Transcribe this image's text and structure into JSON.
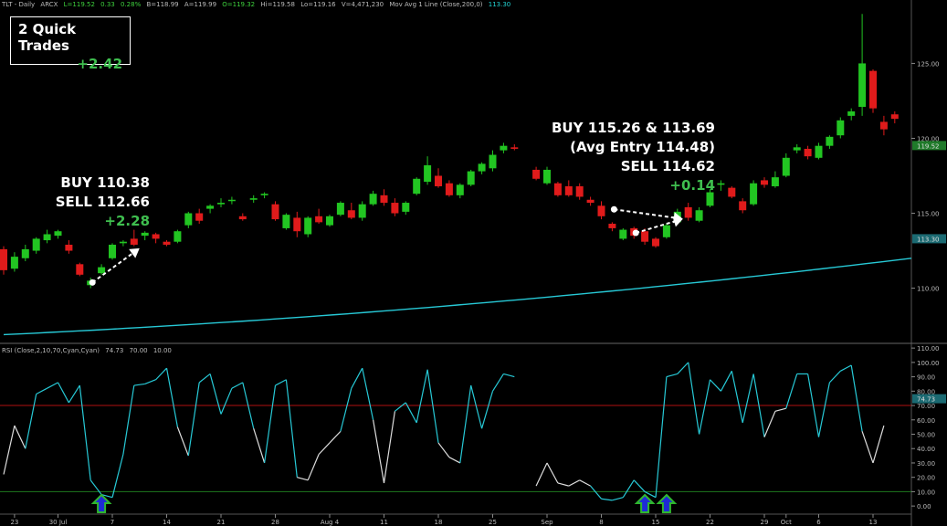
{
  "header": {
    "symbol": "TLT - Daily",
    "exchange": "ARCX",
    "last": "L=119.52",
    "change": "0.33",
    "change_pct": "0.28%",
    "bid": "B=118.99",
    "ask": "A=119.99",
    "open": "O=119.32",
    "high": "Hi=119.58",
    "low": "Lo=119.16",
    "volume": "V=4,471,230",
    "ma_label": "Mov Avg 1 Line (Close,200,0)",
    "ma_value": "113.30"
  },
  "rsi_header": {
    "label": "RSI (Close,2,10,70,Cyan,Cyan)",
    "value": "74.73",
    "overbought": "70.00",
    "oversold": "10.00"
  },
  "summary": {
    "title": "2 Quick Trades",
    "profit": "+2.42"
  },
  "trade1": {
    "buy": "BUY 110.38",
    "sell": "SELL 112.66",
    "profit": "+2.28"
  },
  "trade2": {
    "buy": "BUY 115.26 & 113.69",
    "avg": "(Avg Entry 114.48)",
    "sell": "SELL 114.62",
    "profit": "+0.14"
  },
  "colors": {
    "up": "#22c522",
    "down": "#e01b1b",
    "ma": "#27c9d6",
    "rsi_hi": "#27c9d6",
    "rsi_mid": "#dddddd",
    "ob_line": "#b01010",
    "os_line": "#1e7a1e"
  },
  "chart_data": {
    "type": "candlestick",
    "price_axis": {
      "ticks": [
        "125.00",
        "120.00",
        "115.00",
        "110.00"
      ],
      "last_label": "119.52",
      "ma_label": "113.30",
      "ylim": [
        106.5,
        128.5
      ]
    },
    "rsi_axis": {
      "ticks": [
        "110.00",
        "100.00",
        "90.00",
        "80.00",
        "70.00",
        "60.00",
        "50.00",
        "40.00",
        "30.00",
        "20.00",
        "10.00",
        "0.00"
      ],
      "last_label": "74.73",
      "ylim": [
        -5,
        112
      ]
    },
    "x_labels": [
      {
        "label": "23",
        "i": 1
      },
      {
        "label": "30 Jul",
        "i": 5
      },
      {
        "label": "7",
        "i": 10
      },
      {
        "label": "14",
        "i": 15
      },
      {
        "label": "21",
        "i": 20
      },
      {
        "label": "28",
        "i": 25
      },
      {
        "label": "Aug 4",
        "i": 30
      },
      {
        "label": "11",
        "i": 35
      },
      {
        "label": "18",
        "i": 40
      },
      {
        "label": "25",
        "i": 45
      },
      {
        "label": "Sep",
        "i": 50
      },
      {
        "label": "8",
        "i": 55
      },
      {
        "label": "15",
        "i": 60
      },
      {
        "label": "22",
        "i": 65
      },
      {
        "label": "29",
        "i": 70
      },
      {
        "label": "Oct",
        "i": 72
      },
      {
        "label": "6",
        "i": 75
      },
      {
        "label": "13",
        "i": 80
      }
    ],
    "candles": [
      [
        112.6,
        112.8,
        110.9,
        111.2
      ],
      [
        111.3,
        112.4,
        111.1,
        112.1
      ],
      [
        112.0,
        112.9,
        111.8,
        112.6
      ],
      [
        112.5,
        113.4,
        112.3,
        113.3
      ],
      [
        113.2,
        113.9,
        113.0,
        113.6
      ],
      [
        113.5,
        113.9,
        113.3,
        113.8
      ],
      [
        112.9,
        113.2,
        112.3,
        112.5
      ],
      [
        111.6,
        111.7,
        110.8,
        110.9
      ],
      [
        110.2,
        110.7,
        110.0,
        110.5
      ],
      [
        111.0,
        111.6,
        110.9,
        111.4
      ],
      [
        112.0,
        113.0,
        111.9,
        112.9
      ],
      [
        113.0,
        113.2,
        112.8,
        113.1
      ],
      [
        113.3,
        113.9,
        112.8,
        112.9
      ],
      [
        113.5,
        113.8,
        113.2,
        113.7
      ],
      [
        113.6,
        113.7,
        113.0,
        113.3
      ],
      [
        113.1,
        113.2,
        112.8,
        112.9
      ],
      [
        113.1,
        113.9,
        113.0,
        113.8
      ],
      [
        114.2,
        115.1,
        114.0,
        115.0
      ],
      [
        115.0,
        115.3,
        114.3,
        114.5
      ],
      [
        115.3,
        115.6,
        115.0,
        115.5
      ],
      [
        115.6,
        116.0,
        115.4,
        115.7
      ],
      [
        115.9,
        116.1,
        115.6,
        115.9
      ],
      [
        114.8,
        115.0,
        114.5,
        114.6
      ],
      [
        115.9,
        116.2,
        115.7,
        116.0
      ],
      [
        116.2,
        116.4,
        116.0,
        116.3
      ],
      [
        115.6,
        115.8,
        114.5,
        114.6
      ],
      [
        114.0,
        115.0,
        113.9,
        114.9
      ],
      [
        114.7,
        115.1,
        113.4,
        113.8
      ],
      [
        113.6,
        114.8,
        113.4,
        114.7
      ],
      [
        114.8,
        115.3,
        114.3,
        114.4
      ],
      [
        114.2,
        114.9,
        114.1,
        114.8
      ],
      [
        114.9,
        115.8,
        114.8,
        115.7
      ],
      [
        115.2,
        115.7,
        114.6,
        114.7
      ],
      [
        114.7,
        115.8,
        114.5,
        115.6
      ],
      [
        115.6,
        116.5,
        115.5,
        116.3
      ],
      [
        116.2,
        116.6,
        115.5,
        115.7
      ],
      [
        115.7,
        116.0,
        114.8,
        115.0
      ],
      [
        115.1,
        115.8,
        114.9,
        115.7
      ],
      [
        116.3,
        117.4,
        116.2,
        117.3
      ],
      [
        117.1,
        118.8,
        116.9,
        118.2
      ],
      [
        117.5,
        118.0,
        116.7,
        116.8
      ],
      [
        117.0,
        117.2,
        116.1,
        116.2
      ],
      [
        116.2,
        117.0,
        116.0,
        116.9
      ],
      [
        116.9,
        117.9,
        116.8,
        117.8
      ],
      [
        117.8,
        118.4,
        117.6,
        118.3
      ],
      [
        118.0,
        119.2,
        117.8,
        118.9
      ],
      [
        119.2,
        119.7,
        119.0,
        119.5
      ],
      [
        119.4,
        119.6,
        119.2,
        119.3
      ],
      [
        null,
        null,
        null,
        null
      ],
      [
        117.9,
        118.1,
        117.2,
        117.3
      ],
      [
        117.0,
        118.1,
        116.9,
        117.9
      ],
      [
        117.0,
        117.1,
        116.1,
        116.2
      ],
      [
        116.8,
        117.2,
        116.1,
        116.2
      ],
      [
        116.8,
        117.0,
        115.9,
        116.1
      ],
      [
        115.9,
        116.1,
        115.5,
        115.7
      ],
      [
        115.5,
        115.8,
        114.6,
        114.8
      ],
      [
        114.3,
        114.4,
        113.8,
        114.0
      ],
      [
        113.3,
        114.0,
        113.2,
        113.9
      ],
      [
        114.0,
        114.1,
        113.3,
        113.5
      ],
      [
        113.8,
        114.0,
        112.9,
        113.1
      ],
      [
        113.3,
        113.4,
        112.7,
        112.8
      ],
      [
        113.4,
        114.3,
        113.3,
        114.2
      ],
      [
        114.4,
        115.3,
        114.3,
        115.1
      ],
      [
        115.4,
        115.7,
        114.5,
        114.7
      ],
      [
        114.5,
        115.4,
        114.4,
        115.2
      ],
      [
        115.5,
        116.6,
        115.4,
        116.4
      ],
      [
        116.9,
        117.2,
        116.5,
        117.0
      ],
      [
        116.7,
        116.8,
        116.0,
        116.1
      ],
      [
        115.8,
        116.0,
        115.0,
        115.2
      ],
      [
        115.6,
        117.2,
        115.5,
        117.0
      ],
      [
        117.2,
        117.4,
        116.7,
        116.9
      ],
      [
        116.8,
        117.8,
        116.7,
        117.4
      ],
      [
        117.5,
        119.0,
        117.4,
        118.7
      ],
      [
        119.2,
        119.6,
        119.0,
        119.4
      ],
      [
        119.3,
        119.5,
        118.6,
        118.8
      ],
      [
        118.7,
        119.7,
        118.6,
        119.5
      ],
      [
        119.5,
        120.2,
        119.3,
        120.1
      ],
      [
        120.2,
        121.4,
        120.0,
        121.2
      ],
      [
        121.5,
        122.0,
        121.2,
        121.8
      ],
      [
        122.1,
        128.3,
        121.5,
        125.0
      ],
      [
        124.5,
        124.6,
        121.7,
        122.0
      ],
      [
        121.1,
        121.5,
        120.2,
        120.6
      ],
      [
        121.6,
        121.8,
        121.0,
        121.3
      ]
    ],
    "ma": {
      "start": 106.9,
      "end": 112.0
    },
    "rsi": [
      22,
      56,
      40,
      78,
      82,
      86,
      72,
      84,
      18,
      8,
      6,
      36,
      84,
      85,
      88,
      96,
      55,
      35,
      86,
      92,
      64,
      82,
      86,
      54,
      30,
      84,
      88,
      20,
      18,
      36,
      44,
      52,
      82,
      96,
      60,
      16,
      66,
      72,
      58,
      95,
      44,
      34,
      30,
      84,
      54,
      80,
      92,
      90,
      null,
      14,
      30,
      16,
      14,
      18,
      14,
      5,
      4,
      6,
      18,
      10,
      6,
      90,
      92,
      100,
      50,
      88,
      80,
      94,
      58,
      92,
      48,
      66,
      68,
      92,
      92,
      48,
      86,
      94,
      98,
      52,
      30,
      56
    ],
    "rsi_levels": {
      "overbought": 70,
      "oversold": 10
    },
    "buy_arrows_rsi": [
      9,
      59,
      61
    ],
    "trade_arrows": [
      {
        "from": [
          8,
          110.38
        ],
        "to": [
          12,
          112.66
        ]
      },
      {
        "from": [
          56,
          115.26
        ],
        "to": [
          62,
          114.62
        ]
      },
      {
        "from": [
          58,
          113.69
        ],
        "to": [
          62,
          114.62
        ]
      }
    ]
  }
}
